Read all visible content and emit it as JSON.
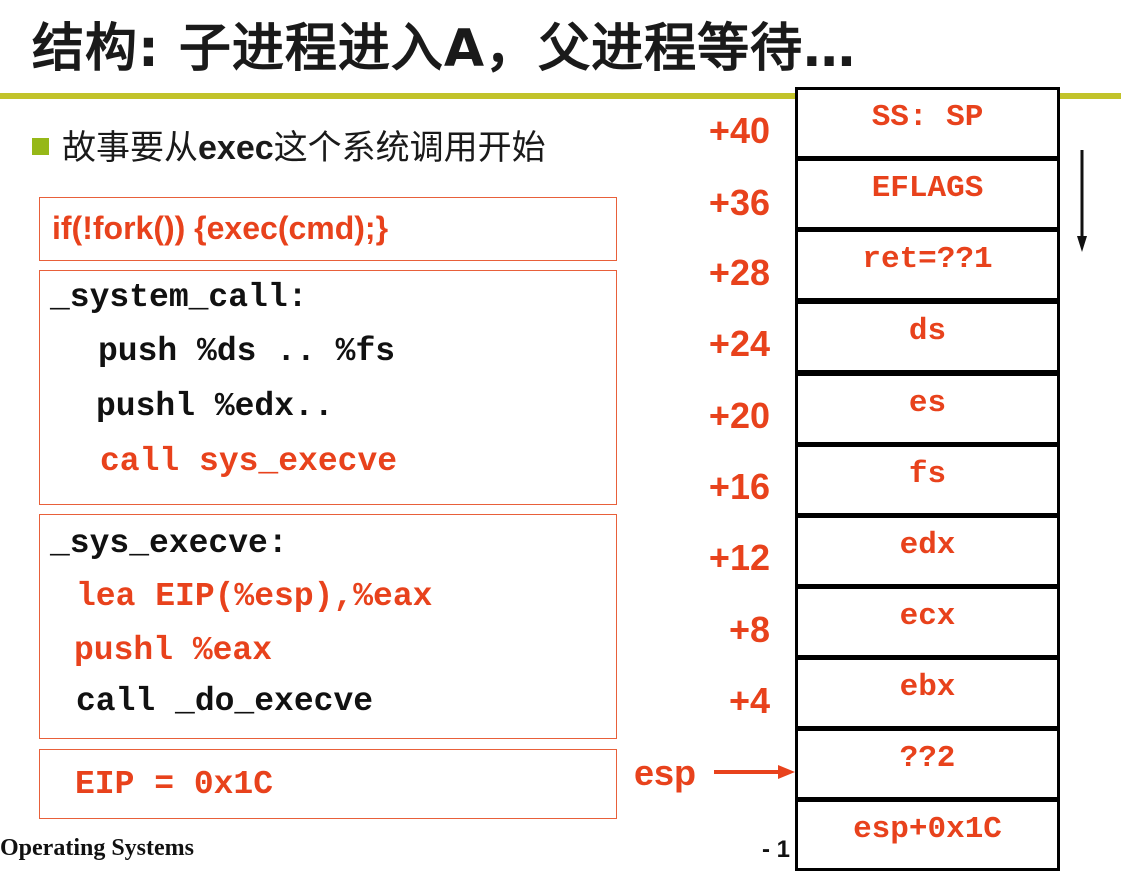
{
  "title": "结构: 子进程进入A，父进程等待…",
  "bullet": {
    "pre": "故事要从",
    "bold": "exec",
    "post": "这个系统调用开始"
  },
  "code_boxes": {
    "fork": "if(!fork()) {exec(cmd);}",
    "system_call": [
      "_system_call:",
      "push %ds .. %fs",
      "pushl %edx..",
      "call sys_execve"
    ],
    "sys_execve": [
      "_sys_execve:",
      "lea EIP(%esp),%eax",
      "pushl %eax",
      "call _do_execve"
    ],
    "eip": "EIP = 0x1C"
  },
  "stack": {
    "offsets": [
      "+40",
      "+36",
      "+28",
      "+24",
      "+20",
      "+16",
      "+12",
      "+8",
      "+4"
    ],
    "cells": [
      "SS: SP",
      "EFLAGS",
      "ret=??1",
      "ds",
      "es",
      "fs",
      "edx",
      "ecx",
      "ebx",
      "??2",
      "esp+0x1C"
    ],
    "esp_label": "esp"
  },
  "footer": {
    "course": "Operating Systems",
    "page": "- 1"
  },
  "colors": {
    "accent_red": "#e8421c",
    "rule_olive": "#c2c32a",
    "bullet_green": "#96b818"
  }
}
